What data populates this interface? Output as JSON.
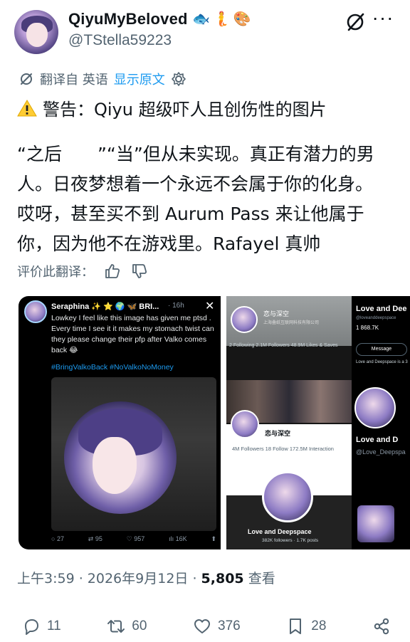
{
  "tweet": {
    "display_name": "QiyuMyBeloved",
    "name_emojis": [
      "🐟",
      "🧜",
      "🎨"
    ],
    "handle": "@TStella59223",
    "translation": {
      "label": "翻译自 英语",
      "show_original": "显示原文"
    },
    "warning": "警告：Qiyu 超级吓人且创伤性的图片",
    "body_lines": [
      "“之后",
      "”“当”但从未实现。真正有潜力的男",
      "人。日夜梦想着一个永远不会属于你的化身。",
      "哎呀，甚至买不到 Aurum Pass 来让他属于",
      "你，因为他不在游戏里。Rafayel 真帅"
    ],
    "rate_label": "评价此翻译："
  },
  "media": {
    "left": {
      "name": "Seraphina ✨ ⭐ 🌍 🦋 BRI...",
      "time": "· 16h",
      "text": "Lowkey I feel like this image has given me ptsd . Every time I see it it makes my stomach twist can they please change their pfp after Valko comes back 😂",
      "hashtags": "#BringValkoBack #NoValkoNoMoney",
      "stats": [
        "27",
        "95",
        "957",
        "16K"
      ]
    },
    "right": {
      "top_name": "恋与深空",
      "top_sub": "上海叠纸互联网科技有限公司",
      "top_stats": "2 Following  2.1M Followers  48.9M Likes & Saves",
      "mid_name": "恋与深空",
      "mid_stats": "4M Followers   18 Follow   172.5M Interaction",
      "bottom_name": "Love and Deepspace",
      "bottom_sub": "382K followers · 1.7K posts",
      "side_name": "Love and Dee",
      "side_handle": "@loveanddeepspace",
      "side_stats": "1   868.7K",
      "side_button": "Message",
      "side_desc": "Love and Deepspace is a 3",
      "side_name2": "Love and D",
      "side_handle2": "@Love_Deepspa"
    }
  },
  "meta": {
    "time": "上午3:59",
    "date": "2026年9月12日",
    "views": "5,805",
    "views_label": "查看"
  },
  "actions": {
    "replies": "11",
    "reposts": "60",
    "likes": "376",
    "bookmarks": "28"
  }
}
